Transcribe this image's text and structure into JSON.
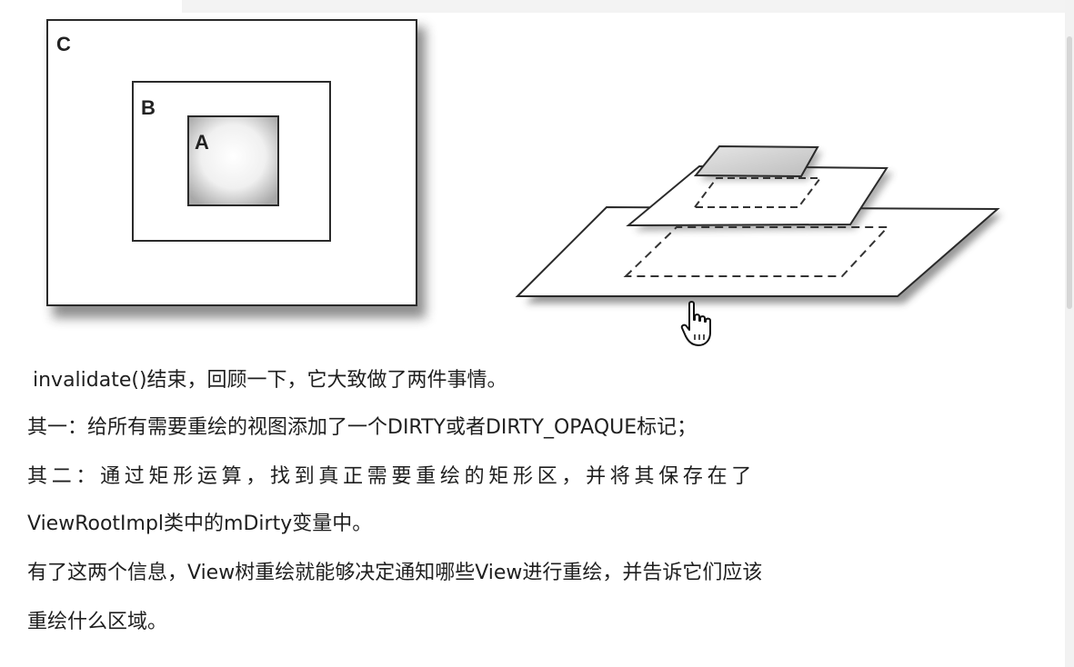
{
  "figure_left": {
    "labels": {
      "outer": "C",
      "middle": "B",
      "inner": "A"
    }
  },
  "cursor_icon": "hand-pointer-icon",
  "text": {
    "p1": "invalidate()结束，回顾一下，它大致做了两件事情。",
    "p2": "其一：给所有需要重绘的视图添加了一个DIRTY或者DIRTY_OPAQUE标记；",
    "p3_line1": "其二：通过矩形运算，找到真正需要重绘的矩形区，并将其保存在了",
    "p3_line2": "ViewRootImpl类中的mDirty变量中。",
    "p4_line1": "有了这两个信息，View树重绘就能够决定通知哪些View进行重绘，并告诉它们应该",
    "p4_line2": "重绘什么区域。"
  }
}
